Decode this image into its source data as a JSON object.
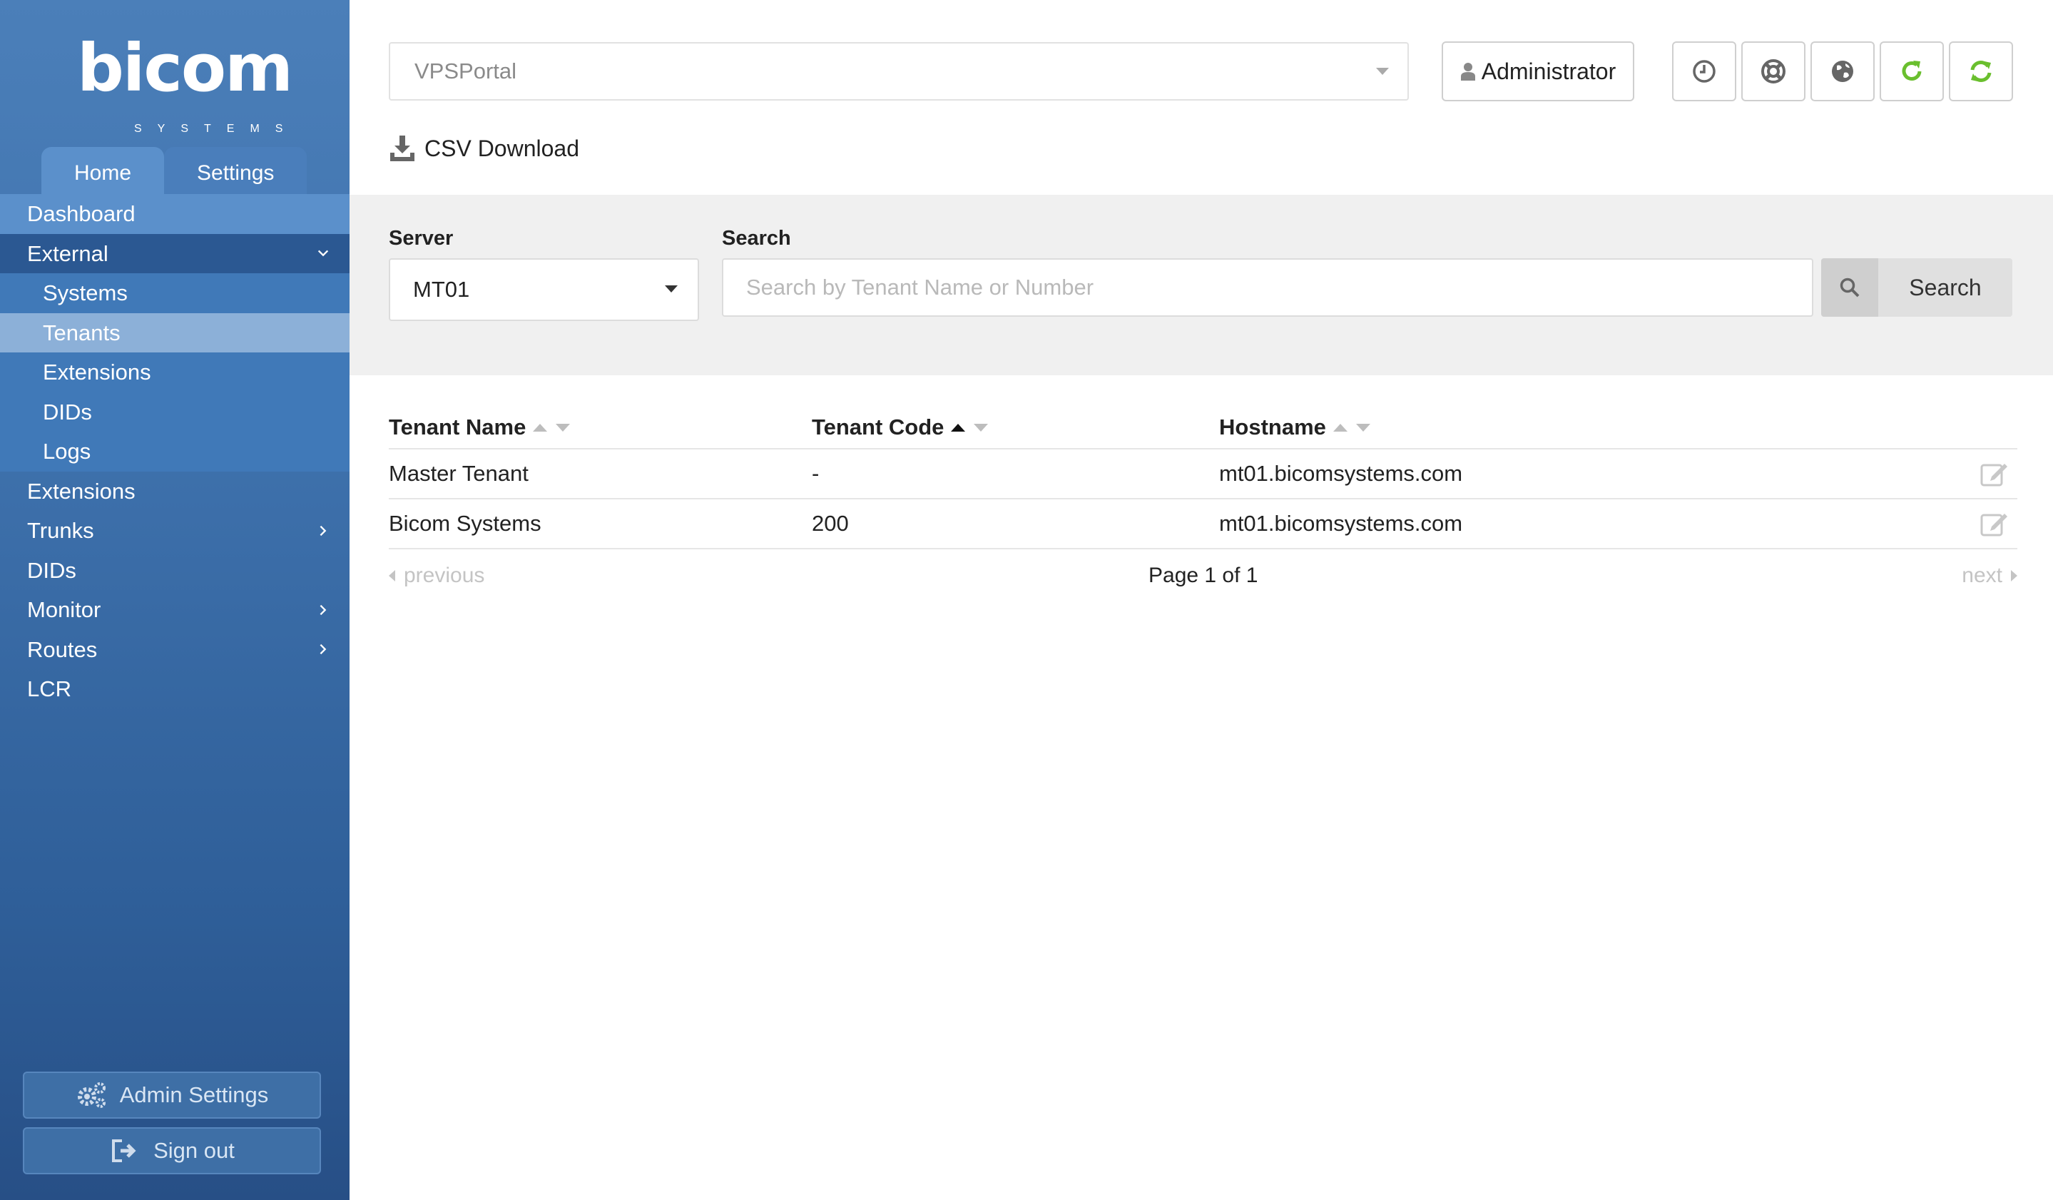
{
  "brand": {
    "logo_text": "bicom",
    "logo_subtext": "SYSTEMS"
  },
  "tabs": [
    {
      "label": "Home"
    },
    {
      "label": "Settings"
    }
  ],
  "nav": [
    {
      "label": "Dashboard"
    },
    {
      "label": "External"
    },
    {
      "label": "Systems"
    },
    {
      "label": "Tenants"
    },
    {
      "label": "Extensions"
    },
    {
      "label": "DIDs"
    },
    {
      "label": "Logs"
    },
    {
      "label": "Extensions"
    },
    {
      "label": "Trunks"
    },
    {
      "label": "DIDs"
    },
    {
      "label": "Monitor"
    },
    {
      "label": "Routes"
    },
    {
      "label": "LCR"
    }
  ],
  "sidebar_footer": {
    "admin_settings": "Admin Settings",
    "sign_out": "Sign out"
  },
  "topbar": {
    "portal_select": "VPSPortal",
    "user_button": "Administrator",
    "icons": [
      "clock-icon",
      "lifebuoy-icon",
      "globe-icon",
      "reload-icon",
      "sync-icon"
    ],
    "csv_download": "CSV Download"
  },
  "filters": {
    "server_label": "Server",
    "server_value": "MT01",
    "search_label": "Search",
    "search_placeholder": "Search by Tenant Name or Number",
    "search_value": "",
    "search_button": "Search"
  },
  "table": {
    "columns": [
      "Tenant Name",
      "Tenant Code",
      "Hostname"
    ],
    "rows": [
      {
        "name": "Master Tenant",
        "code": "-",
        "hostname": "mt01.bicomsystems.com"
      },
      {
        "name": "Bicom Systems",
        "code": "200",
        "hostname": "mt01.bicomsystems.com"
      }
    ]
  },
  "pagination": {
    "previous": "previous",
    "page_info": "Page 1 of 1",
    "next": "next"
  },
  "colors": {
    "sidebar": "#3f72ad",
    "accent_green": "#6abf2e",
    "selected_item": "#8cb0d8"
  }
}
